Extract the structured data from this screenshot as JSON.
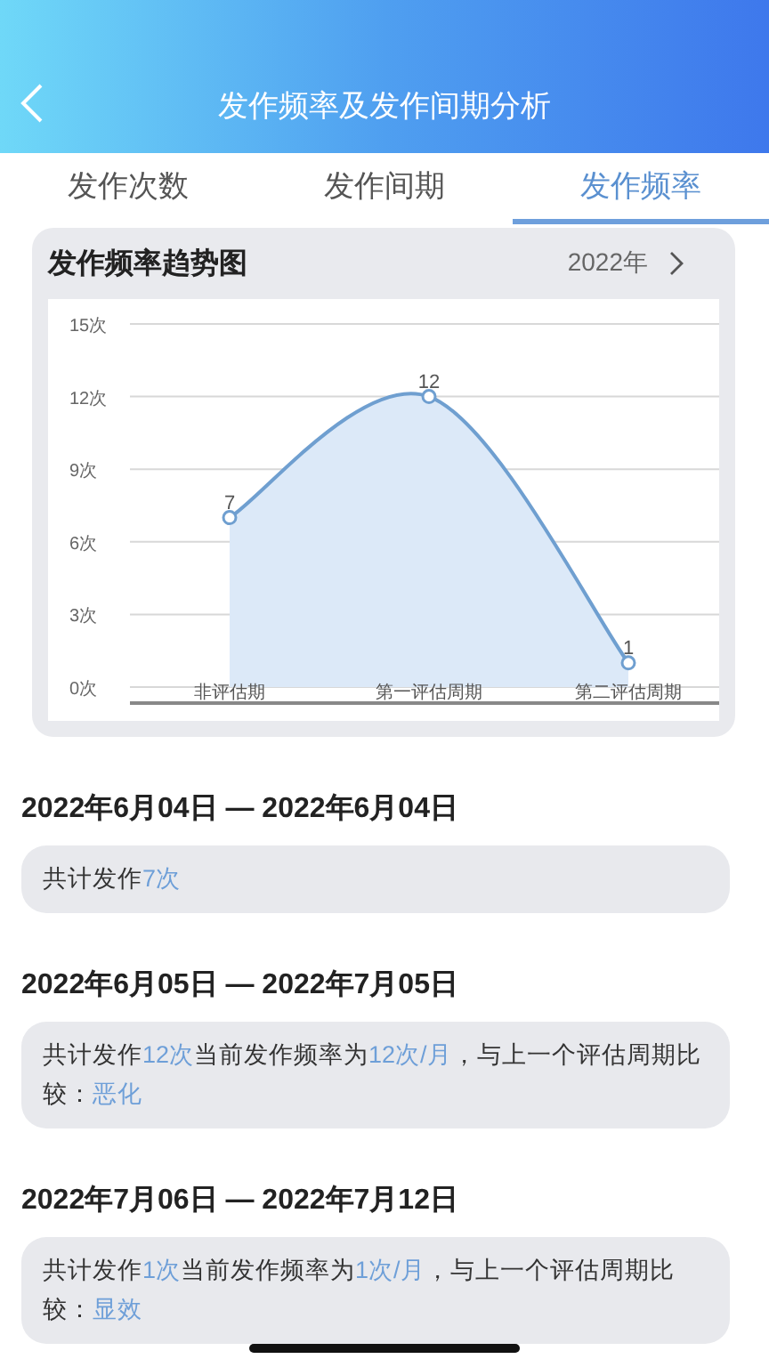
{
  "header": {
    "title": "发作频率及发作间期分析"
  },
  "tabs": [
    {
      "label": "发作次数",
      "selected": false
    },
    {
      "label": "发作间期",
      "selected": false
    },
    {
      "label": "发作频率",
      "selected": true
    }
  ],
  "chart_card": {
    "title": "发作频率趋势图",
    "year": "2022年",
    "chart_data": {
      "type": "area",
      "categories": [
        "非评估期",
        "第一评估周期",
        "第二评估周期"
      ],
      "series": [
        {
          "color": "#6f9fd0",
          "values": [
            7,
            12,
            1
          ]
        }
      ],
      "ylim": [
        0,
        15
      ],
      "yticks": [
        {
          "value": 0,
          "label": "0次"
        },
        {
          "value": 3,
          "label": "3次"
        },
        {
          "value": 6,
          "label": "6次"
        },
        {
          "value": 9,
          "label": "9次"
        },
        {
          "value": 12,
          "label": "12次"
        },
        {
          "value": 15,
          "label": "15次"
        }
      ],
      "data_labels": true,
      "grid": true
    }
  },
  "periods": [
    {
      "range": "2022年6月04日 — 2022年6月04日",
      "summary": [
        {
          "text": "共计发作",
          "highlight": false
        },
        {
          "text": "7次",
          "highlight": true
        }
      ]
    },
    {
      "range": "2022年6月05日 — 2022年7月05日",
      "summary": [
        {
          "text": "共计发作",
          "highlight": false
        },
        {
          "text": "12次",
          "highlight": true
        },
        {
          "text": "当前发作频率为",
          "highlight": false
        },
        {
          "text": "12次/月",
          "highlight": true
        },
        {
          "text": "，与上一个评估周期比较：",
          "highlight": false
        },
        {
          "text": "恶化",
          "highlight": true
        }
      ]
    },
    {
      "range": "2022年7月06日 — 2022年7月12日",
      "summary": [
        {
          "text": "共计发作",
          "highlight": false
        },
        {
          "text": "1次",
          "highlight": true
        },
        {
          "text": "当前发作频率为",
          "highlight": false
        },
        {
          "text": "1次/月",
          "highlight": true
        },
        {
          "text": "，与上一个评估周期比较：",
          "highlight": false
        },
        {
          "text": "显效",
          "highlight": true
        }
      ]
    }
  ]
}
